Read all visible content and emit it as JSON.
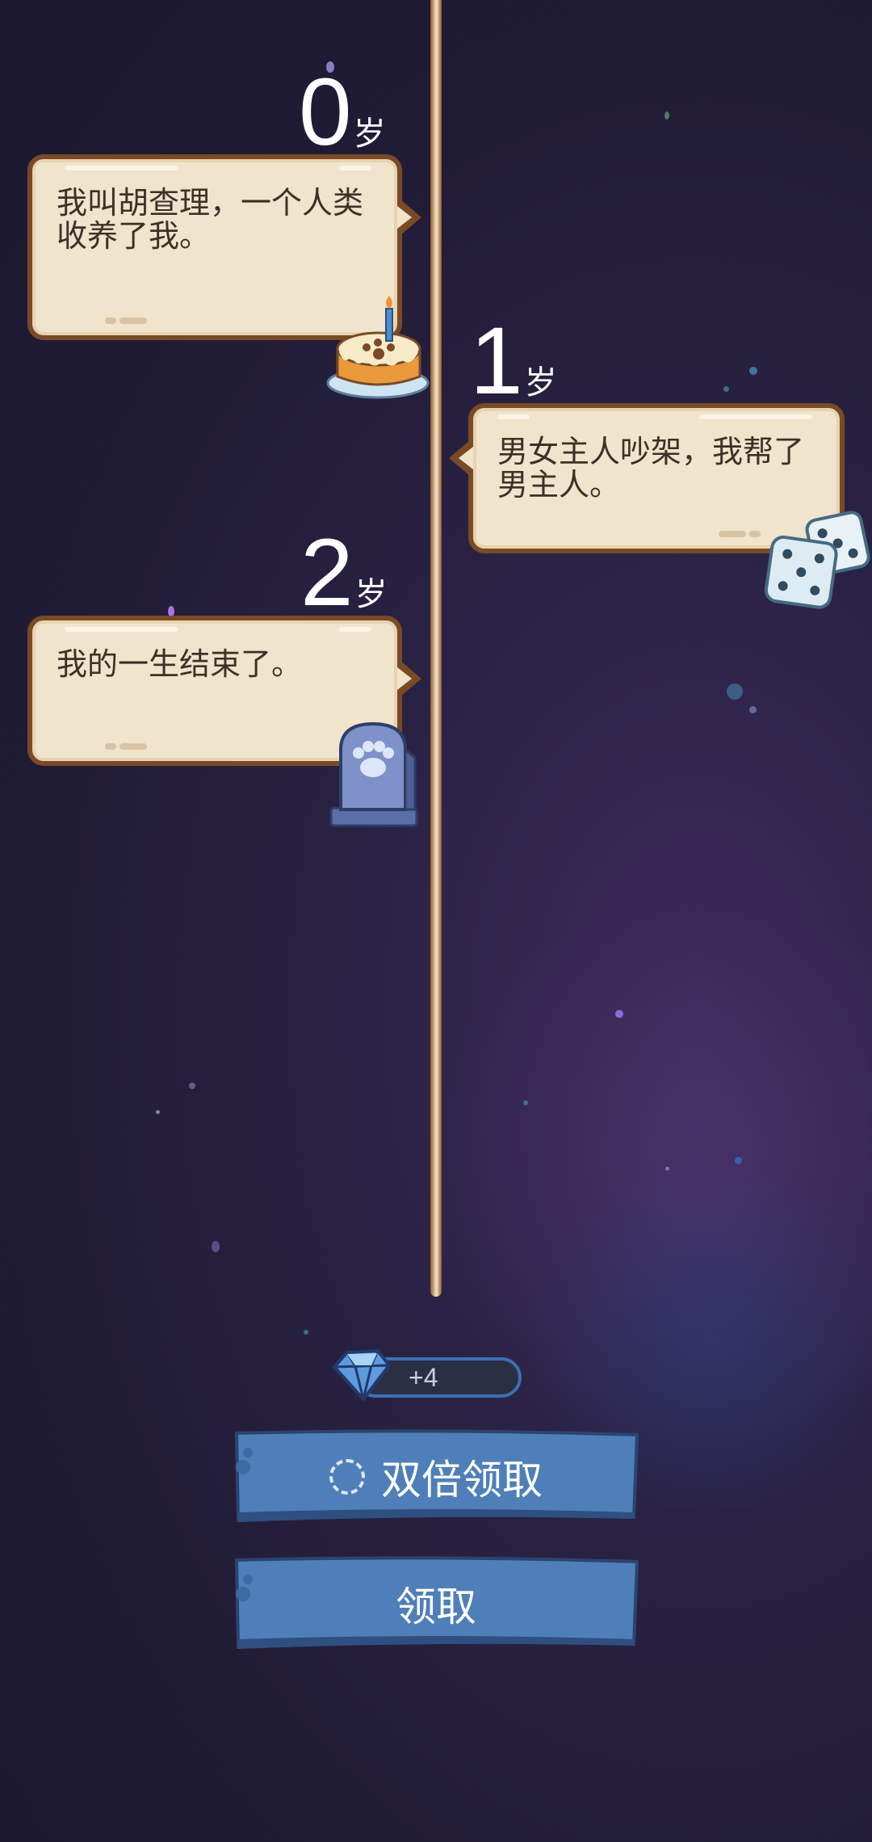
{
  "timeline": [
    {
      "age": "0",
      "unit": "岁",
      "text": "我叫胡查理，一个人类收养了我。",
      "icon": "birthday-cake-icon"
    },
    {
      "age": "1",
      "unit": "岁",
      "text": "男女主人吵架，我帮了男主人。",
      "icon": "dice-icon"
    },
    {
      "age": "2",
      "unit": "岁",
      "text": "我的一生结束了。",
      "icon": "paw-tombstone-icon"
    }
  ],
  "reward": {
    "amount": "+4",
    "icon": "gem-icon"
  },
  "buttons": {
    "double_claim": "双倍领取",
    "claim": "领取"
  },
  "colors": {
    "card_bg": "#f1e4cc",
    "card_border": "#7a4a27",
    "button_blue": "#4f7fb8"
  }
}
